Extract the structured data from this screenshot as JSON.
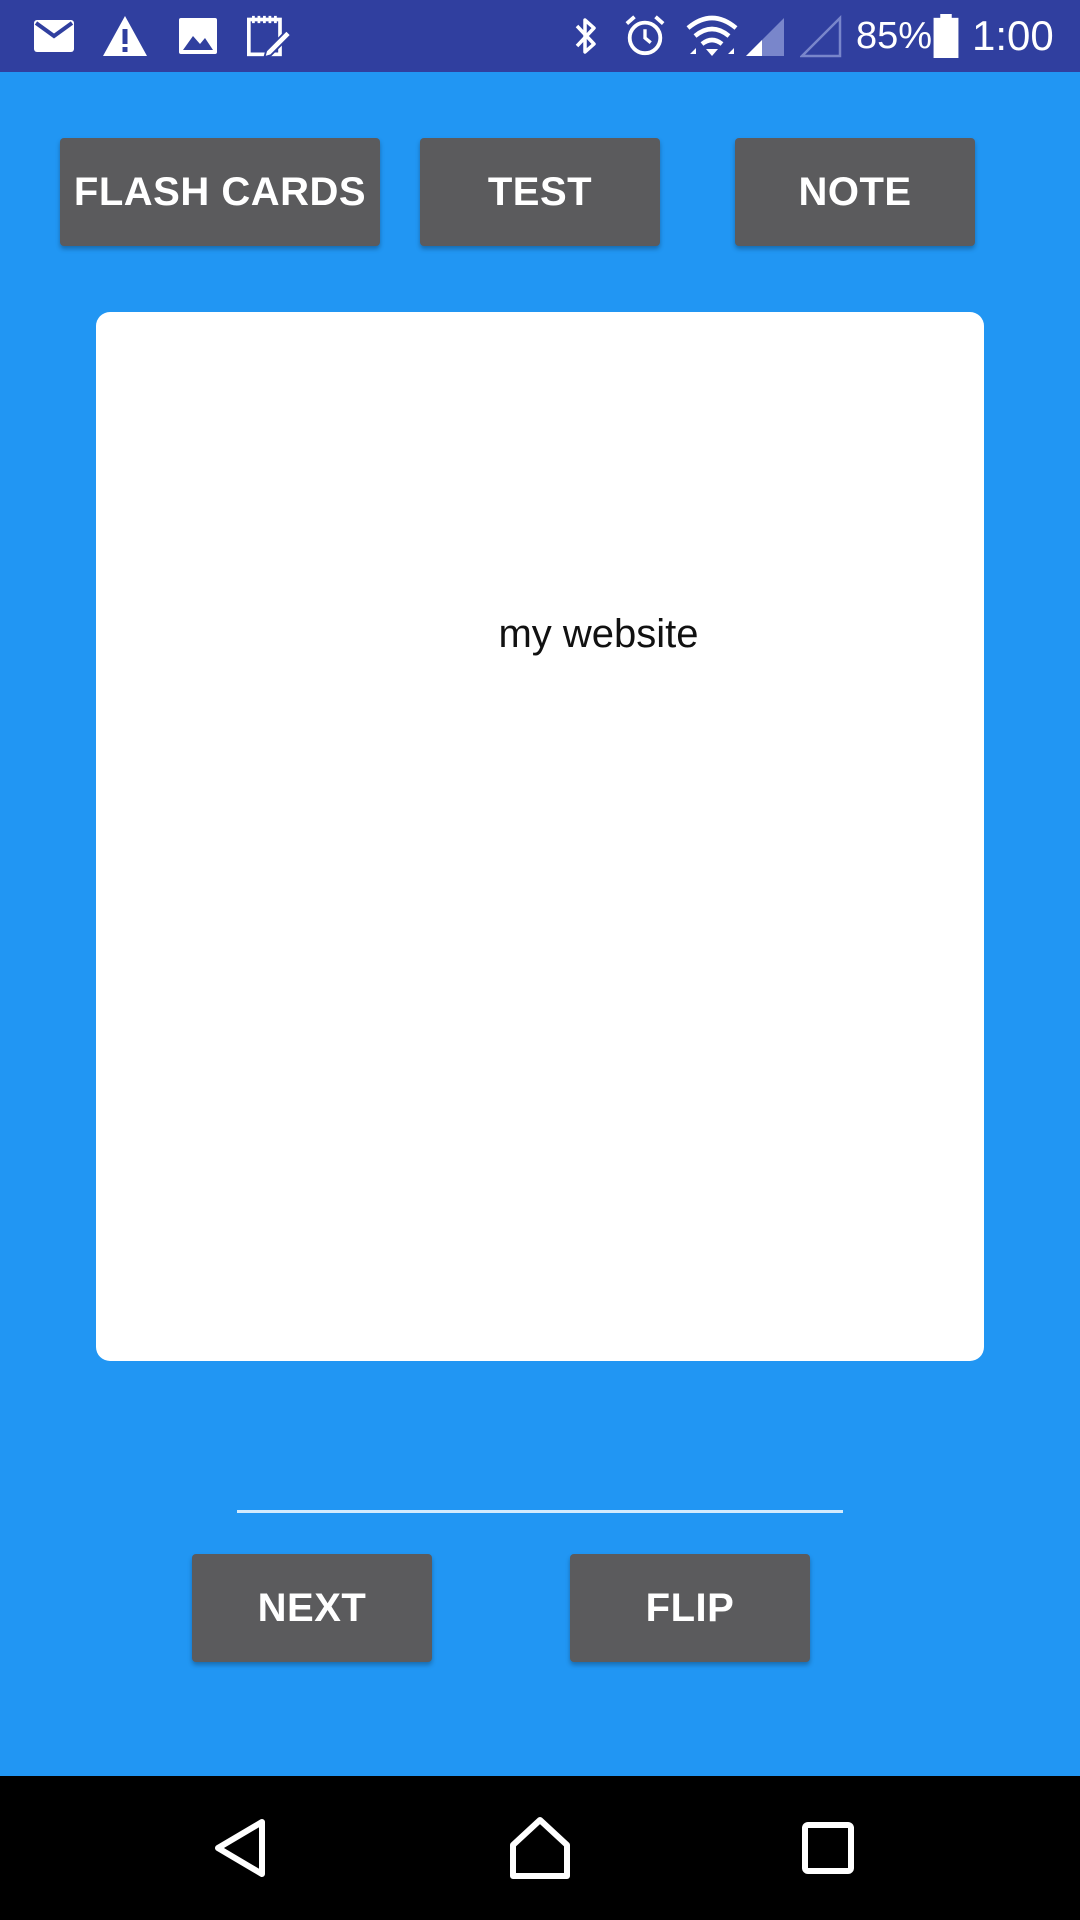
{
  "status_bar": {
    "battery_percent": "85%",
    "time": "1:00",
    "left_icons": [
      "email-icon",
      "warning-icon",
      "image-icon",
      "notepad-icon"
    ],
    "right_icons": [
      "bluetooth-icon",
      "alarm-icon",
      "wifi-icon",
      "signal-icon",
      "signal-empty-icon",
      "battery-icon"
    ],
    "background_color": "#303F9F"
  },
  "top_buttons": {
    "flash_cards": "FLASH CARDS",
    "test": "TEST",
    "note": "NOTE"
  },
  "card": {
    "text": "my website"
  },
  "bottom_buttons": {
    "next": "NEXT",
    "flip": "FLIP"
  },
  "nav_bar": {
    "icons": [
      "back-icon",
      "home-icon",
      "recents-icon"
    ]
  },
  "colors": {
    "background": "#2196F3",
    "button": "#5B5B5D",
    "card": "#FFFFFF"
  }
}
